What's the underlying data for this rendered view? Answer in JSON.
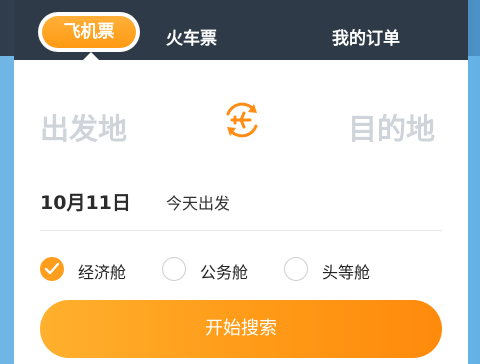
{
  "tabs": {
    "flight": "飞机票",
    "train": "火车票",
    "orders": "我的订单"
  },
  "route": {
    "from_placeholder": "出发地",
    "to_placeholder": "目的地",
    "swap_icon": "plane-swap-icon"
  },
  "date": {
    "value": "10月11日",
    "note": "今天出发"
  },
  "cabin": {
    "options": [
      {
        "label": "经济舱",
        "checked": true
      },
      {
        "label": "公务舱",
        "checked": false
      },
      {
        "label": "头等舱",
        "checked": false
      }
    ]
  },
  "search_label": "开始搜索",
  "colors": {
    "accent": "#ff9d1c",
    "tabbar": "#2e3a47",
    "placeholder": "#cfd4da"
  }
}
